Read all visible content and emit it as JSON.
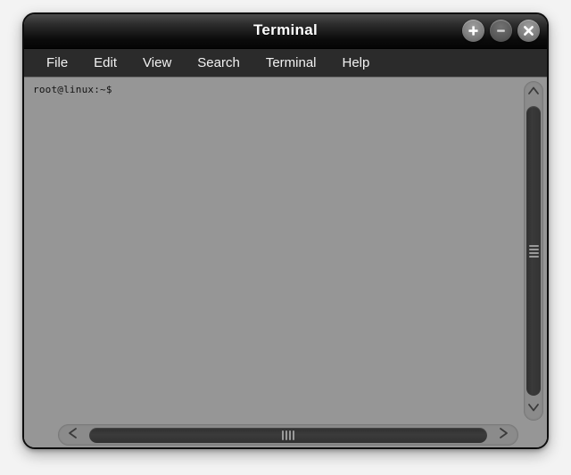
{
  "window": {
    "title": "Terminal",
    "controls": [
      {
        "name": "maximize",
        "glyph": "plus",
        "style": "light"
      },
      {
        "name": "minimize",
        "glyph": "minus",
        "style": "dim"
      },
      {
        "name": "close",
        "glyph": "x",
        "style": "light"
      }
    ]
  },
  "menubar": {
    "items": [
      {
        "label": "File"
      },
      {
        "label": "Edit"
      },
      {
        "label": "View"
      },
      {
        "label": "Search"
      },
      {
        "label": "Terminal"
      },
      {
        "label": "Help"
      }
    ]
  },
  "terminal": {
    "lines": [
      "root@linux:~$"
    ],
    "prompt_user": "root",
    "prompt_host": "linux",
    "prompt_path": "~",
    "prompt_symbol": "$"
  },
  "scrollbars": {
    "vertical": {
      "up_icon": "chevron-up-icon",
      "down_icon": "chevron-down-icon",
      "grip_lines": 4
    },
    "horizontal": {
      "left_icon": "chevron-left-icon",
      "right_icon": "chevron-right-icon",
      "grip_lines": 4
    }
  },
  "colors": {
    "terminal_background": "#969696",
    "terminal_text": "#131313",
    "titlebar_top": "#4b4b4b",
    "titlebar_bottom": "#050505",
    "menubar": "#2b2b2b",
    "menu_text": "#f2f2f2",
    "scrollbar_track": "#8b8b8b",
    "scrollbar_thumb": "#333333",
    "desktop_background": "#f3f3f3"
  }
}
